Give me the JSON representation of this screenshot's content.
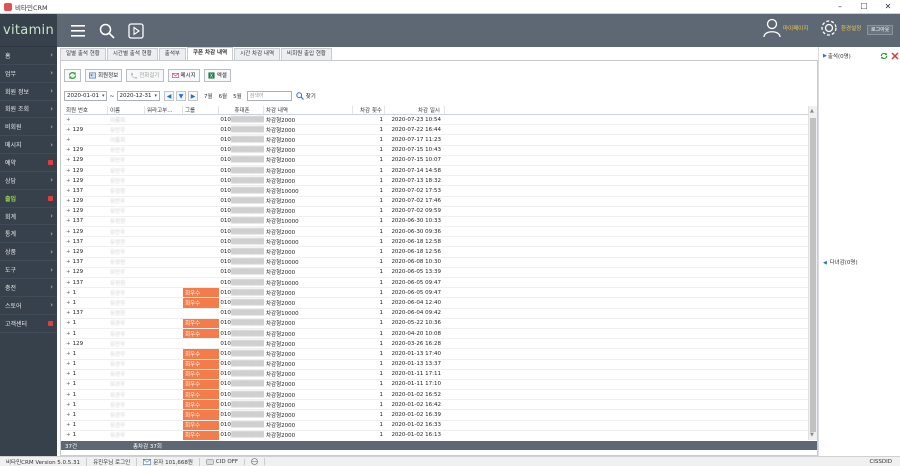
{
  "window": {
    "title": "비타민CRM"
  },
  "brand": {
    "logo": "vitamin"
  },
  "sidebar": {
    "items": [
      {
        "label": "홈",
        "indicator": "chevron"
      },
      {
        "label": "업무",
        "indicator": "chevron"
      },
      {
        "label": "회원 정보",
        "indicator": "chevron"
      },
      {
        "label": "회원 조회",
        "indicator": "chevron"
      },
      {
        "label": "비회원",
        "indicator": "chevron"
      },
      {
        "label": "메시지",
        "indicator": "chevron"
      },
      {
        "label": "예약",
        "indicator": "dot"
      },
      {
        "label": "상담",
        "indicator": "chevron"
      },
      {
        "label": "출입",
        "indicator": "dot",
        "active": true
      },
      {
        "label": "회계",
        "indicator": "chevron"
      },
      {
        "label": "통계",
        "indicator": "chevron"
      },
      {
        "label": "상품",
        "indicator": "chevron"
      },
      {
        "label": "도구",
        "indicator": "chevron"
      },
      {
        "label": "충전",
        "indicator": "chevron"
      },
      {
        "label": "스토어",
        "indicator": "chevron"
      },
      {
        "label": "고객센터",
        "indicator": "dot"
      }
    ]
  },
  "topbar": {
    "user_label": "마이페이지",
    "settings_label": "환경설정",
    "logout_label": "로그아웃"
  },
  "tabs": [
    "일별 출석 현황",
    "시간별 출석 현황",
    "출석부",
    "쿠폰 차감 내역",
    "시간 차감 내역",
    "비회원 출입 현황"
  ],
  "active_tab": 3,
  "toolbar": {
    "member_info": "회원정보",
    "call": "전화걸기",
    "message": "메시지",
    "excel": "엑셀"
  },
  "filter": {
    "date_from": "2020-01-01",
    "date_to": "2020-12-31",
    "m7": "7월",
    "m6": "6월",
    "m5": "5월",
    "search_placeholder": "검색어",
    "find": "찾기"
  },
  "table": {
    "columns": [
      "회원 번호",
      "이름",
      "워라고부...",
      "그룹",
      "휴대폰",
      "차감 내역",
      "차감 횟수",
      "차감 일시"
    ],
    "rows": [
      {
        "no": "",
        "name": "이름회",
        "grp": "",
        "phone": "010",
        "item": "차감형2000",
        "cnt": "1",
        "dt": "2020-07-23 10:54"
      },
      {
        "no": "129",
        "name": "유민우",
        "grp": "",
        "phone": "010",
        "item": "차감형2000",
        "cnt": "1",
        "dt": "2020-07-22 16:44"
      },
      {
        "no": "",
        "name": "이름회",
        "grp": "",
        "phone": "010",
        "item": "차감형2000",
        "cnt": "1",
        "dt": "2020-07-17 11:23"
      },
      {
        "no": "129",
        "name": "유민우",
        "grp": "",
        "phone": "010",
        "item": "차감형2000",
        "cnt": "1",
        "dt": "2020-07-15 10:43"
      },
      {
        "no": "129",
        "name": "유민우",
        "grp": "",
        "phone": "010",
        "item": "차감형2000",
        "cnt": "1",
        "dt": "2020-07-15 10:07"
      },
      {
        "no": "129",
        "name": "유민우",
        "grp": "",
        "phone": "010",
        "item": "차감형2000",
        "cnt": "1",
        "dt": "2020-07-14 14:58"
      },
      {
        "no": "129",
        "name": "유민우",
        "grp": "",
        "phone": "010",
        "item": "차감형2000",
        "cnt": "1",
        "dt": "2020-07-13 18:32"
      },
      {
        "no": "137",
        "name": "유정현",
        "grp": "",
        "phone": "010",
        "item": "차감형10000",
        "cnt": "1",
        "dt": "2020-07-02 17:53"
      },
      {
        "no": "129",
        "name": "유민우",
        "grp": "",
        "phone": "010",
        "item": "차감형2000",
        "cnt": "1",
        "dt": "2020-07-02 17:46"
      },
      {
        "no": "129",
        "name": "유민우",
        "grp": "",
        "phone": "010",
        "item": "차감형2000",
        "cnt": "1",
        "dt": "2020-07-02 09:59"
      },
      {
        "no": "137",
        "name": "유정현",
        "grp": "",
        "phone": "010",
        "item": "차감형10000",
        "cnt": "1",
        "dt": "2020-06-30 10:33"
      },
      {
        "no": "129",
        "name": "유민우",
        "grp": "",
        "phone": "010",
        "item": "차감형2000",
        "cnt": "1",
        "dt": "2020-06-30 09:36"
      },
      {
        "no": "137",
        "name": "유정현",
        "grp": "",
        "phone": "010",
        "item": "차감형10000",
        "cnt": "1",
        "dt": "2020-06-18 12:58"
      },
      {
        "no": "129",
        "name": "유민우",
        "grp": "",
        "phone": "010",
        "item": "차감형2000",
        "cnt": "1",
        "dt": "2020-06-18 12:56"
      },
      {
        "no": "137",
        "name": "유정현",
        "grp": "",
        "phone": "010",
        "item": "차감형10000",
        "cnt": "1",
        "dt": "2020-06-08 10:30"
      },
      {
        "no": "129",
        "name": "유민우",
        "grp": "",
        "phone": "010",
        "item": "차감형2000",
        "cnt": "1",
        "dt": "2020-06-05 13:39"
      },
      {
        "no": "137",
        "name": "유정현",
        "grp": "",
        "phone": "010",
        "item": "차감형10000",
        "cnt": "1",
        "dt": "2020-06-05 09:47"
      },
      {
        "no": "1",
        "name": "유관우",
        "grp": "회우수",
        "phone": "010",
        "item": "차감형2000",
        "cnt": "1",
        "dt": "2020-06-05 09:47"
      },
      {
        "no": "1",
        "name": "유관우",
        "grp": "회우수",
        "phone": "010",
        "item": "차감형2000",
        "cnt": "1",
        "dt": "2020-06-04 12:40"
      },
      {
        "no": "137",
        "name": "유정현",
        "grp": "",
        "phone": "010",
        "item": "차감형10000",
        "cnt": "1",
        "dt": "2020-06-04 09:42"
      },
      {
        "no": "1",
        "name": "유관우",
        "grp": "회우수",
        "phone": "010",
        "item": "차감형2000",
        "cnt": "1",
        "dt": "2020-05-22 10:36"
      },
      {
        "no": "1",
        "name": "유관우",
        "grp": "회우수",
        "phone": "010",
        "item": "차감형2000",
        "cnt": "1",
        "dt": "2020-04-20 10:08"
      },
      {
        "no": "129",
        "name": "유민우",
        "grp": "",
        "phone": "010",
        "item": "차감형2000",
        "cnt": "1",
        "dt": "2020-03-26 16:28"
      },
      {
        "no": "1",
        "name": "유관우",
        "grp": "회우수",
        "phone": "010",
        "item": "차감형2000",
        "cnt": "1",
        "dt": "2020-01-13 17:40"
      },
      {
        "no": "1",
        "name": "유관우",
        "grp": "회우수",
        "phone": "010",
        "item": "차감형2000",
        "cnt": "1",
        "dt": "2020-01-13 13:37"
      },
      {
        "no": "1",
        "name": "유관우",
        "grp": "회우수",
        "phone": "010",
        "item": "차감형2000",
        "cnt": "1",
        "dt": "2020-01-11 17:11"
      },
      {
        "no": "1",
        "name": "유관우",
        "grp": "회우수",
        "phone": "010",
        "item": "차감형2000",
        "cnt": "1",
        "dt": "2020-01-11 17:10"
      },
      {
        "no": "1",
        "name": "유관우",
        "grp": "회우수",
        "phone": "010",
        "item": "차감형2000",
        "cnt": "1",
        "dt": "2020-01-02 16:52"
      },
      {
        "no": "1",
        "name": "유관우",
        "grp": "회우수",
        "phone": "010",
        "item": "차감형2000",
        "cnt": "1",
        "dt": "2020-01-02 16:42"
      },
      {
        "no": "1",
        "name": "유관우",
        "grp": "회우수",
        "phone": "010",
        "item": "차감형2000",
        "cnt": "1",
        "dt": "2020-01-02 16:39"
      },
      {
        "no": "1",
        "name": "유관우",
        "grp": "회우수",
        "phone": "010",
        "item": "차감형2000",
        "cnt": "1",
        "dt": "2020-01-02 16:33"
      },
      {
        "no": "1",
        "name": "유관우",
        "grp": "회우수",
        "phone": "010",
        "item": "차감형2000",
        "cnt": "1",
        "dt": "2020-01-02 16:13"
      }
    ],
    "footer_count": "37건",
    "footer_total": "총차감 37회"
  },
  "right_panel": {
    "in_label": "출석(0명)",
    "out_label": "다녀감(0명)"
  },
  "statusbar": {
    "version": "비타민CRM Version 5.0.5.31",
    "login": "유진우님 로그인",
    "balance": "문자 101,668원",
    "cid": "CID OFF",
    "right": "CISSDID"
  },
  "colors": {
    "sidebar": "#37414c",
    "topbar": "#5d6874",
    "accent_green": "#9ed64a",
    "group_badge": "#f47b4a",
    "user_yellow": "#f2c94c"
  }
}
